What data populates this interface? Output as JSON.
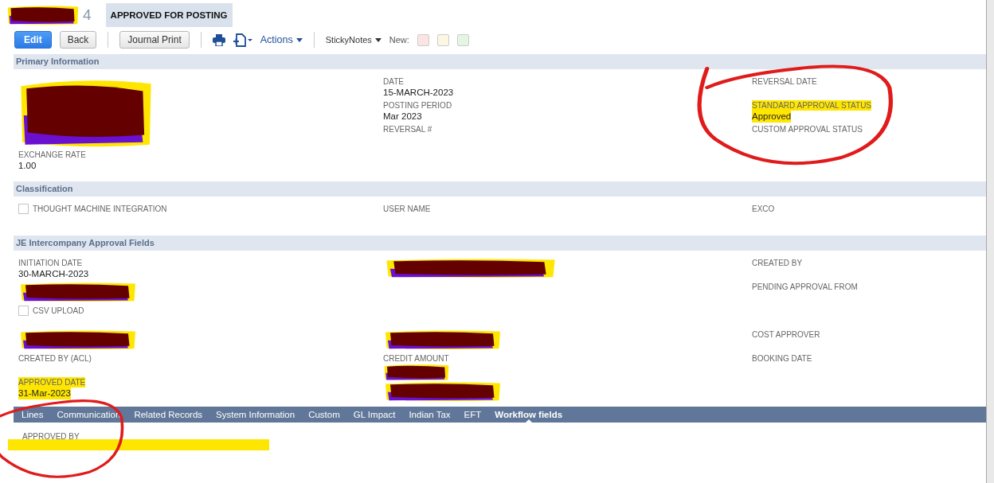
{
  "record": {
    "title_redacted": true,
    "number": "4",
    "status": "APPROVED FOR POSTING"
  },
  "toolbar": [
    {
      "kind": "primary",
      "label": "Edit"
    },
    {
      "kind": "button",
      "label": "Back"
    },
    {
      "kind": "separator"
    },
    {
      "kind": "button",
      "label": "Journal Print"
    },
    {
      "kind": "separator"
    },
    {
      "kind": "print"
    },
    {
      "kind": "new-doc"
    },
    {
      "kind": "menu",
      "label": "Actions"
    },
    {
      "kind": "separator"
    },
    {
      "kind": "small-menu",
      "label": "StickyNotes"
    },
    {
      "kind": "text",
      "label": "New:"
    }
  ],
  "sticky_notes": [
    {
      "color": "#fce4e4"
    },
    {
      "color": "#fcf7e2"
    },
    {
      "color": "#e4f6e2"
    }
  ],
  "sections": [
    {
      "title": "Primary Information",
      "columns": [
        [
          {
            "kind": "blot"
          },
          {
            "kind": "field",
            "label": "EXCHANGE RATE",
            "value": "1.00"
          }
        ],
        [
          {
            "kind": "field",
            "label": "DATE",
            "value": "15-MARCH-2023"
          },
          {
            "kind": "field",
            "label": "POSTING PERIOD",
            "value": "Mar 2023"
          },
          {
            "kind": "field",
            "label": "REVERSAL #"
          }
        ],
        [
          {
            "kind": "field",
            "label": "REVERSAL DATE"
          },
          {
            "kind": "field",
            "label": "STANDARD APPROVAL STATUS",
            "value": "Approved",
            "highlighted": true,
            "circled": true
          },
          {
            "kind": "field",
            "label": "CUSTOM APPROVAL STATUS"
          }
        ]
      ]
    },
    {
      "title": "Classification",
      "columns": [
        [
          {
            "kind": "checkbox",
            "label": "THOUGHT MACHINE INTEGRATION",
            "checked": false
          }
        ],
        [
          {
            "kind": "field",
            "label": "USER NAME"
          }
        ],
        [
          {
            "kind": "field",
            "label": "EXCO"
          }
        ]
      ]
    },
    {
      "title": "JE Intercompany Approval Fields",
      "columns": [
        [
          {
            "kind": "field",
            "label": "INITIATION DATE",
            "value": "30-MARCH-2023"
          },
          {
            "kind": "strike"
          },
          {
            "kind": "checkbox",
            "label": "CSV UPLOAD",
            "checked": false
          },
          {
            "kind": "strike"
          },
          {
            "kind": "field",
            "label": "CREATED BY (ACL)"
          },
          {
            "kind": "field",
            "label": "APPROVED DATE",
            "value": "31-Mar-2023",
            "highlighted": true
          }
        ],
        [
          {
            "kind": "bar"
          },
          {
            "kind": "blank"
          },
          {
            "kind": "blank"
          },
          {
            "kind": "strike"
          },
          {
            "kind": "field",
            "label": "CREDIT AMOUNT",
            "value_redacted": true
          },
          {
            "kind": "strike"
          }
        ],
        [
          {
            "kind": "field",
            "label": "CREATED BY"
          },
          {
            "kind": "field",
            "label": "PENDING APPROVAL FROM"
          },
          {
            "kind": "blank"
          },
          {
            "kind": "field",
            "label": "COST APPROVER"
          },
          {
            "kind": "field",
            "label": "BOOKING DATE"
          }
        ]
      ]
    }
  ],
  "subtabs": [
    {
      "label": "Lines",
      "selected": false
    },
    {
      "label": "Communication",
      "selected": false
    },
    {
      "label": "Related Records",
      "selected": false
    },
    {
      "label": "System Information",
      "selected": false
    },
    {
      "label": "Custom",
      "selected": false
    },
    {
      "label": "GL Impact",
      "selected": false
    },
    {
      "label": "Indian Tax",
      "selected": false
    },
    {
      "label": "EFT",
      "selected": false
    },
    {
      "label": "Workflow fields",
      "selected": true
    }
  ],
  "workflow_fields": [
    {
      "label": "APPROVED BY",
      "highlighted": true,
      "circled": true
    }
  ]
}
